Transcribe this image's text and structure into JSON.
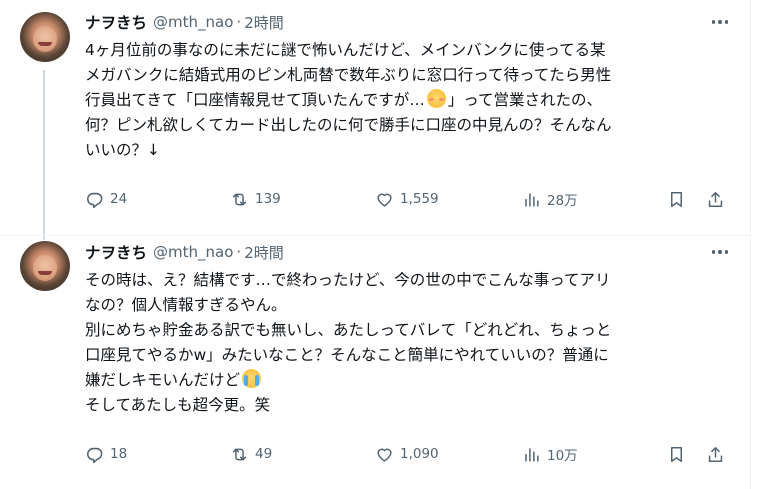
{
  "tweets": [
    {
      "author_name": "ナヲきち",
      "handle": "@mth_nao",
      "separator": "·",
      "time": "2時間",
      "lines": [
        {
          "text": "4ヶ月位前の事なのに未だに謎で怖いんだけど、メインバンクに使ってる某"
        },
        {
          "text": "メガバンクに結婚式用のピン札両替で数年ぶりに窓口行って待ってたら男性"
        },
        {
          "text": "行員出てきて「口座情報見せて頂いたんですが…",
          "emoji": "smiling-face-with-blush",
          "after": "」って営業されたの、"
        },
        {
          "text": "何？ピン札欲しくてカード出したのに何で勝手に口座の中見んの？そんなん"
        },
        {
          "text": "いいの？↓"
        }
      ],
      "stats": {
        "replies": "24",
        "retweets": "139",
        "likes": "1,559",
        "views": "28万"
      }
    },
    {
      "author_name": "ナヲきち",
      "handle": "@mth_nao",
      "separator": "·",
      "time": "2時間",
      "lines": [
        {
          "text": "その時は、え？結構です…で終わったけど、今の世の中でこんな事ってアリ"
        },
        {
          "text": "なの？個人情報すぎるやん。"
        },
        {
          "text": "別にめちゃ貯金ある訳でも無いし、あたしってバレて「どれどれ、ちょっと"
        },
        {
          "text": "口座見てやるかw」みたいなこと？そんなこと簡単にやれていいの？普通に"
        },
        {
          "text": "嫌だしキモいんだけど",
          "emoji": "loudly-crying-face",
          "after": ""
        },
        {
          "text": "そしてあたしも超今更。笑"
        }
      ],
      "stats": {
        "replies": "18",
        "retweets": "49",
        "likes": "1,090",
        "views": "10万"
      }
    }
  ],
  "icons": {
    "reply": "reply-icon",
    "retweet": "retweet-icon",
    "like": "like-icon",
    "views": "views-icon",
    "bookmark": "bookmark-icon",
    "share": "share-icon",
    "more": "more-options-icon"
  },
  "colors": {
    "text": "#0f1419",
    "secondary": "#536471",
    "thread_line": "#cfd9de",
    "divider": "#eff3f4"
  }
}
